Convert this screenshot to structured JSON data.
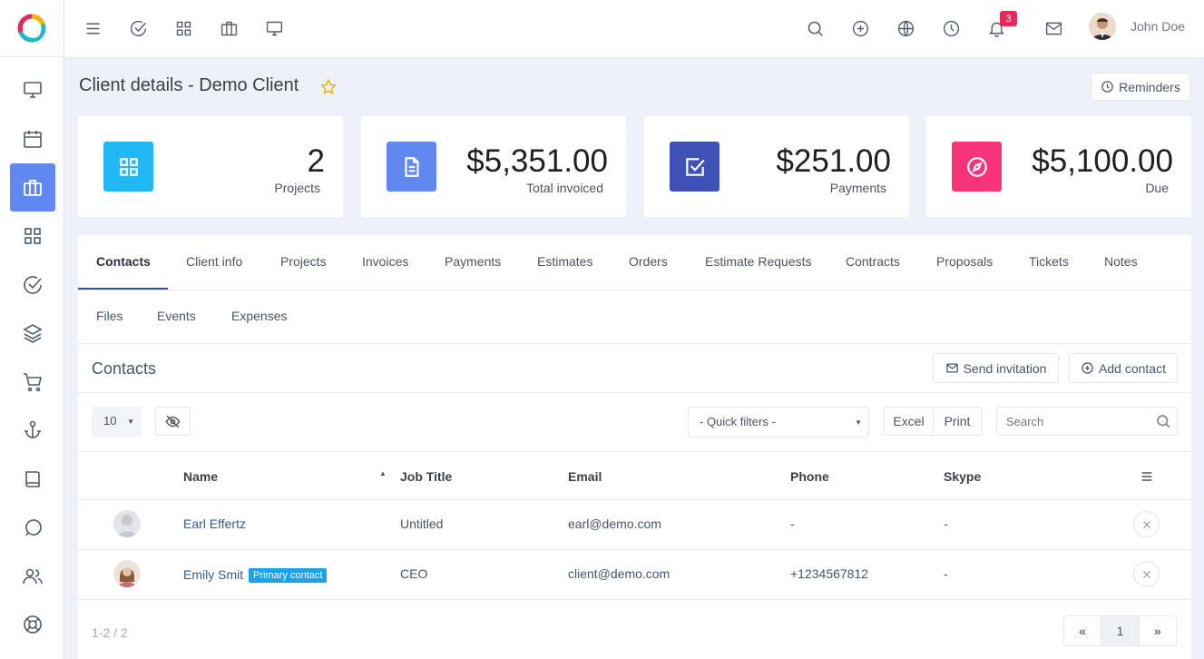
{
  "topbar": {
    "user_name": "John Doe",
    "notification_count": "3"
  },
  "page": {
    "title": "Client details - Demo Client",
    "reminders_label": "Reminders"
  },
  "stats": [
    {
      "value": "2",
      "label": "Projects",
      "color": "#22b7f5"
    },
    {
      "value": "$5,351.00",
      "label": "Total invoiced",
      "color": "#6088f0"
    },
    {
      "value": "$251.00",
      "label": "Payments",
      "color": "#3f51b5"
    },
    {
      "value": "$5,100.00",
      "label": "Due",
      "color": "#f7347a"
    }
  ],
  "tabs": [
    "Contacts",
    "Client info",
    "Projects",
    "Invoices",
    "Payments",
    "Estimates",
    "Orders",
    "Estimate Requests",
    "Contracts",
    "Proposals",
    "Tickets",
    "Notes",
    "Files",
    "Events",
    "Expenses"
  ],
  "contacts": {
    "title": "Contacts",
    "send_invitation_label": "Send invitation",
    "add_contact_label": "Add contact",
    "page_size": "10",
    "quick_filters": "- Quick filters -",
    "excel_label": "Excel",
    "print_label": "Print",
    "search_placeholder": "Search",
    "columns": [
      "Name",
      "Job Title",
      "Email",
      "Phone",
      "Skype"
    ],
    "rows": [
      {
        "name": "Earl Effertz",
        "job_title": "Untitled",
        "email": "earl@demo.com",
        "phone": "-",
        "skype": "-",
        "badge": ""
      },
      {
        "name": "Emily Smit",
        "job_title": "CEO",
        "email": "client@demo.com",
        "phone": "+1234567812",
        "skype": "-",
        "badge": "Primary contact"
      }
    ],
    "footer_count": "1-2 / 2",
    "pager": {
      "prev": "«",
      "current": "1",
      "next": "»"
    }
  }
}
